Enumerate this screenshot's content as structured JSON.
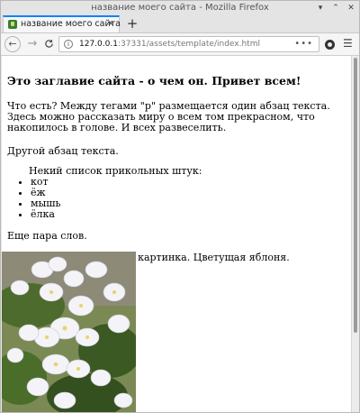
{
  "window": {
    "title": "название моего сайта - Mozilla Firefox",
    "controls": {
      "minimize": "▾",
      "maximize": "⌃",
      "close": "✕"
    }
  },
  "tab": {
    "label": "название моего сайта",
    "close": "✕"
  },
  "newtab_label": "+",
  "nav": {
    "back": "←",
    "forward": "→",
    "reload": "C",
    "url_host": "127.0.0.1",
    "url_rest": ":37331/assets/template/index.html",
    "more": "•••",
    "menu": "☰"
  },
  "page": {
    "heading": "Это заглавие сайта - о чем он. Привет всем!",
    "paragraph1": "Что есть? Между тегами \"p\" размещается один абзац текста. Здесь можно рассказать миру о всем том прекрасном, что накопилось в голове. И всех развеселить.",
    "paragraph2": "Другой абзац текста.",
    "list_caption": "Некий список прикольных штук:",
    "list_items": [
      "кот",
      "ёж",
      "мышь",
      "ёлка"
    ],
    "paragraph3": "Еще пара слов.",
    "paragraph4": "В теге img размещается картинка. Цветущая яблоня."
  },
  "colors": {
    "tab_accent": "#0a84ff",
    "leaf_dark": "#3b5a23",
    "blossom": "#f4f3f7"
  },
  "icons": {
    "favicon": "site-favicon-icon",
    "info": "info-icon",
    "extension": "extension-icon",
    "menu": "hamburger-menu-icon"
  }
}
